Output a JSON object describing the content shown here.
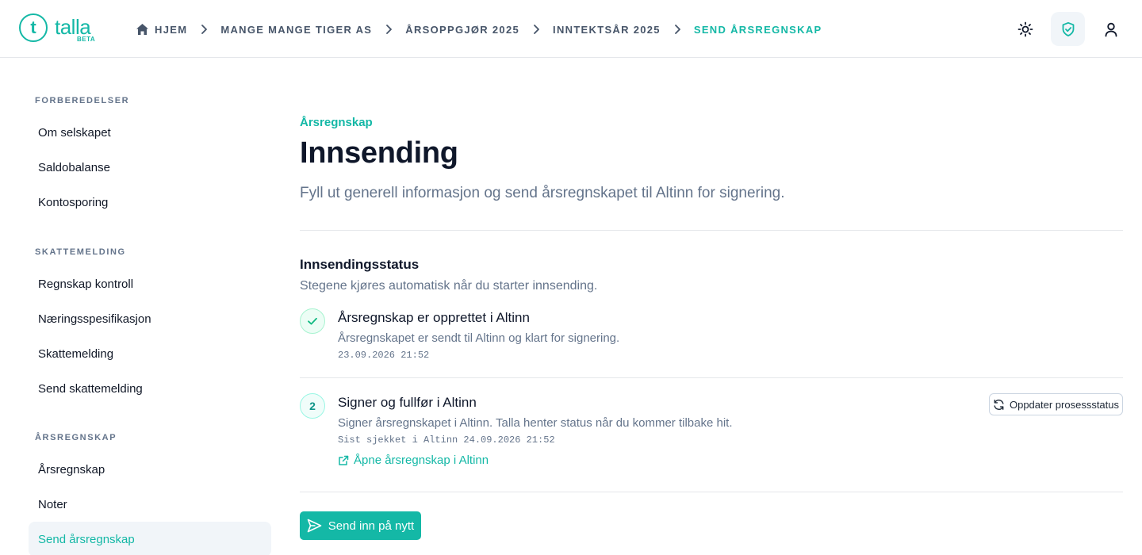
{
  "brand": {
    "name": "talla",
    "badge": "BETA",
    "mark": "t"
  },
  "breadcrumb": {
    "home": "HJEM",
    "items": [
      "MANGE MANGE TIGER AS",
      "ÅRSOPPGJØR 2025",
      "INNTEKTSÅR 2025"
    ],
    "current": "SEND ÅRSREGNSKAP"
  },
  "header_icons": [
    "sun-icon",
    "shield-check-icon",
    "user-icon"
  ],
  "sidebar": {
    "sections": [
      {
        "heading": "FORBEREDELSER",
        "items": [
          "Om selskapet",
          "Saldobalanse",
          "Kontosporing"
        ]
      },
      {
        "heading": "SKATTEMELDING",
        "items": [
          "Regnskap kontroll",
          "Næringsspesifikasjon",
          "Skattemelding",
          "Send skattemelding"
        ]
      },
      {
        "heading": "ÅRSREGNSKAP",
        "items": [
          "Årsregnskap",
          "Noter",
          "Send årsregnskap"
        ]
      }
    ],
    "active": "Send årsregnskap"
  },
  "main": {
    "eyebrow": "Årsregnskap",
    "title": "Innsending",
    "subtitle": "Fyll ut generell informasjon og send årsregnskapet til Altinn for signering.",
    "status": {
      "title": "Innsendingsstatus",
      "description": "Stegene kjøres automatisk når du starter innsending.",
      "steps": [
        {
          "state": "done",
          "title": "Årsregnskap er opprettet i Altinn",
          "description": "Årsregnskapet er sendt til Altinn og klart for signering.",
          "timestamp": "23.09.2026 21:52"
        },
        {
          "state": "current",
          "number": "2",
          "title": "Signer og fullfør i Altinn",
          "description": "Signer årsregnskapet i Altinn. Talla henter status når du kommer tilbake hit.",
          "timestamp": "Sist sjekket i Altinn 24.09.2026 21:52",
          "link": "Åpne årsregnskap i Altinn",
          "refresh_button": "Oppdater prosessstatus"
        }
      ]
    },
    "submit_button": "Send inn på nytt"
  },
  "colors": {
    "accent": "#14b8a6",
    "muted": "#64748b",
    "text": "#0f172a",
    "active_bg": "#f1f5f9"
  }
}
